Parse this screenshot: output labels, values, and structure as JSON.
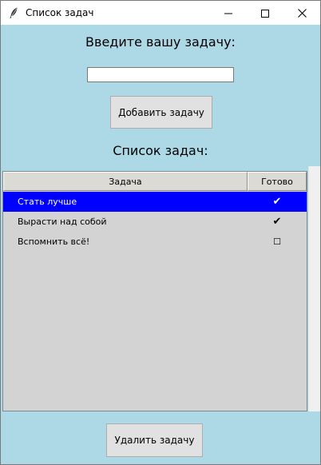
{
  "window": {
    "title": "Список задач",
    "app_icon": "feather-icon",
    "background": "#add8e6"
  },
  "titlebar_buttons": {
    "minimize_icon": "minimize-icon",
    "maximize_icon": "maximize-icon",
    "close_icon": "close-icon"
  },
  "input_section": {
    "prompt": "Введите вашу задачу:",
    "input_value": "",
    "add_button": "Добавить задачу"
  },
  "list_section": {
    "heading": "Список задач:",
    "columns": [
      "Задача",
      "Готово"
    ],
    "rows": [
      {
        "task": "Стать лучше",
        "done": "✔",
        "selected": true
      },
      {
        "task": "Вырасти над собой",
        "done": "✔",
        "selected": false
      },
      {
        "task": "Вспомнить всё!",
        "done": "☐",
        "selected": false
      }
    ],
    "selection_color": "#0000ff",
    "list_background": "#d3d3d3"
  },
  "delete_button": "Удалить задачу"
}
